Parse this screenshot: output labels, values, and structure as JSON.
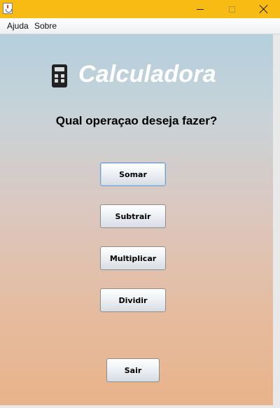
{
  "menubar": {
    "items": [
      {
        "label": "Ajuda"
      },
      {
        "label": "Sobre"
      }
    ]
  },
  "header": {
    "title": "Calculadora",
    "icon": "calculator-icon"
  },
  "main": {
    "question": "Qual operaçao deseja fazer?",
    "buttons": {
      "somar": "Somar",
      "subtrair": "Subtrair",
      "multiplicar": "Multiplicar",
      "dividir": "Dividir",
      "sair": "Sair"
    }
  },
  "colors": {
    "titlebar": "#f8bb14",
    "title_text": "#ffffff",
    "background_top": "#b4cfdd",
    "background_bottom": "#e8b38a"
  }
}
